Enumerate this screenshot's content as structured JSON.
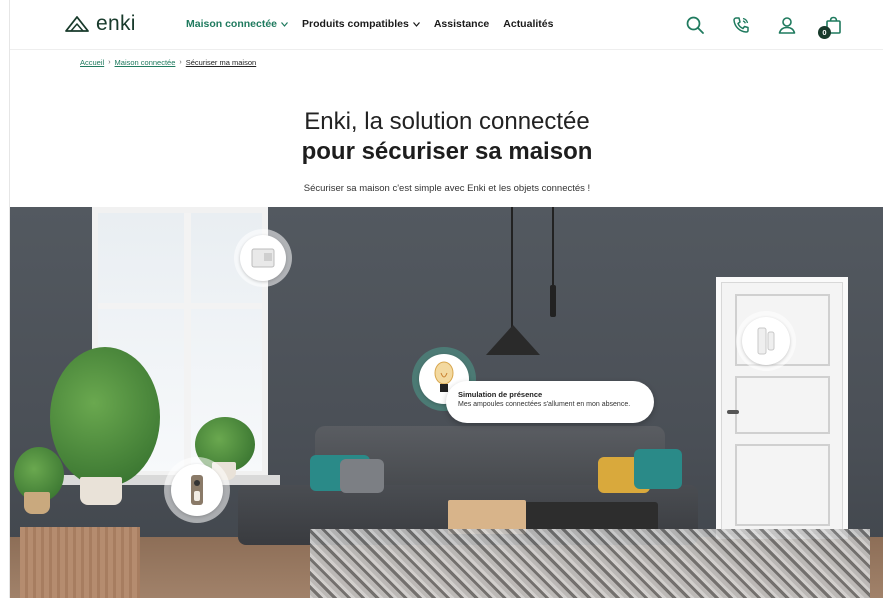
{
  "brand": {
    "name": "enki",
    "color": "#183a2b",
    "accent": "#1f7a5e"
  },
  "nav": [
    {
      "label": "Maison connectée",
      "active": true,
      "has_dropdown": true
    },
    {
      "label": "Produits compatibles",
      "active": false,
      "has_dropdown": true
    },
    {
      "label": "Assistance",
      "active": false,
      "has_dropdown": false
    },
    {
      "label": "Actualités",
      "active": false,
      "has_dropdown": false
    }
  ],
  "header_icons": [
    "search-icon",
    "phone-icon",
    "user-icon",
    "cart-icon"
  ],
  "cart": {
    "count": "0"
  },
  "breadcrumb": {
    "items": [
      "Accueil",
      "Maison connectée"
    ],
    "separator": "›",
    "current": "Sécuriser ma maison"
  },
  "hero": {
    "line1": "Enki, la solution connectée",
    "line2": "pour sécuriser sa maison",
    "subtitle": "Sécuriser sa maison c'est simple avec Enki et les objets connectés !"
  },
  "hotspots": [
    {
      "name": "camera-hotspot",
      "icon": "camera-icon"
    },
    {
      "name": "smart-bulb-hotspot",
      "icon": "bulb-icon",
      "active": true
    },
    {
      "name": "door-sensor-hotspot",
      "icon": "door-sensor-icon"
    },
    {
      "name": "doorbell-hotspot",
      "icon": "doorbell-icon"
    }
  ],
  "tooltip": {
    "title": "Simulation de présence",
    "text": "Mes ampoules connectées s'allument en mon absence."
  }
}
